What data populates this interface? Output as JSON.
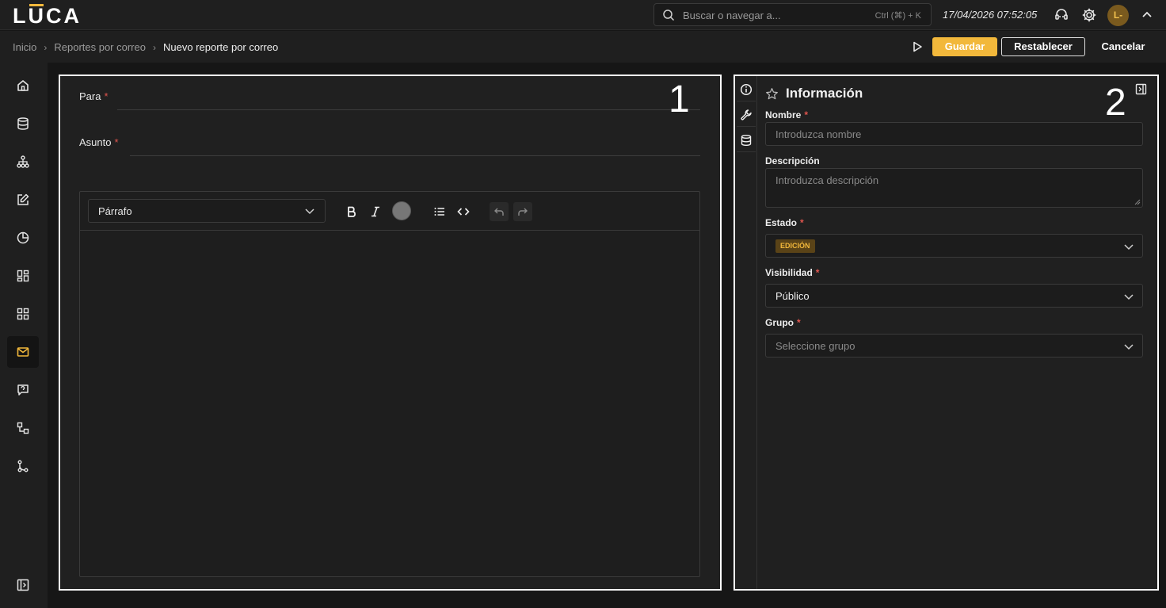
{
  "app": {
    "logo": "LUCA",
    "search_placeholder": "Buscar o navegar a...",
    "search_shortcut": "Ctrl (⌘) + K",
    "datetime": "17/04/2026 07:52:05",
    "avatar_initials": "L-"
  },
  "breadcrumb": {
    "items": [
      "Inicio",
      "Reportes por correo"
    ],
    "current": "Nuevo reporte por correo"
  },
  "actions": {
    "save": "Guardar",
    "reset": "Restablecer",
    "cancel": "Cancelar"
  },
  "sidebar": {
    "items": [
      {
        "icon": "home-icon"
      },
      {
        "icon": "database-icon"
      },
      {
        "icon": "hierarchy-icon"
      },
      {
        "icon": "edit-icon"
      },
      {
        "icon": "pie-chart-icon"
      },
      {
        "icon": "dashboard-icon"
      },
      {
        "icon": "grid-icon"
      },
      {
        "icon": "mail-icon",
        "active": true
      },
      {
        "icon": "chat-icon"
      },
      {
        "icon": "flow-icon"
      },
      {
        "icon": "branch-icon"
      }
    ],
    "collapse_icon": "expand-sidebar-icon"
  },
  "editor": {
    "annotation": "1",
    "to_label": "Para",
    "subject_label": "Asunto",
    "required_mark": "*",
    "format_select": "Párrafo"
  },
  "info": {
    "annotation": "2",
    "title": "Información",
    "name_label": "Nombre",
    "name_placeholder": "Introduzca nombre",
    "description_label": "Descripción",
    "description_placeholder": "Introduzca descripción",
    "state_label": "Estado",
    "state_value": "EDICIÓN",
    "visibility_label": "Visibilidad",
    "visibility_value": "Público",
    "group_label": "Grupo",
    "group_placeholder": "Seleccione grupo"
  },
  "colors": {
    "accent": "#f2b83b",
    "required": "#e0554e",
    "background": "#161616",
    "panel": "#202020"
  }
}
